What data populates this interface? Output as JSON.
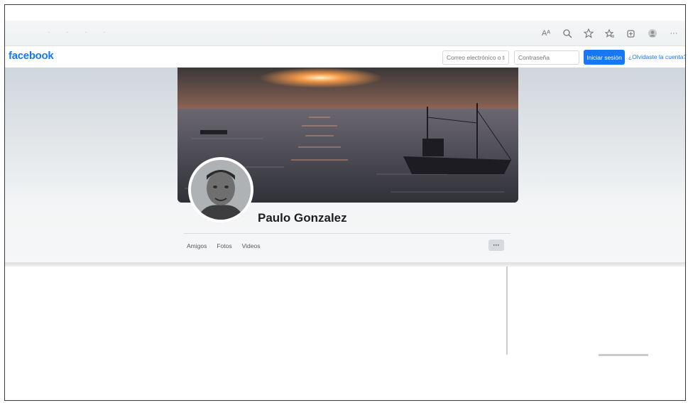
{
  "browser": {
    "icons": [
      "read-aloud-icon",
      "zoom-icon",
      "favorite-add-icon",
      "favorites-icon",
      "collections-icon",
      "profile-icon",
      "more-icon"
    ],
    "read_aloud_glyph": "Aᴬ",
    "more_glyph": "···"
  },
  "header": {
    "logo": "facebook",
    "email_placeholder": "Correo electrónico o tel",
    "password_placeholder": "Contraseña",
    "login_button": "Iniciar sesión",
    "forgot_link": "¿Olvidaste la cuenta?"
  },
  "profile": {
    "name": "Paulo Gonzalez",
    "tabs": [
      "Amigos",
      "Fotos",
      "Videos"
    ],
    "more_button": "···"
  },
  "colors": {
    "brand": "#1877f2",
    "frame_border": "#3a3a3a"
  }
}
